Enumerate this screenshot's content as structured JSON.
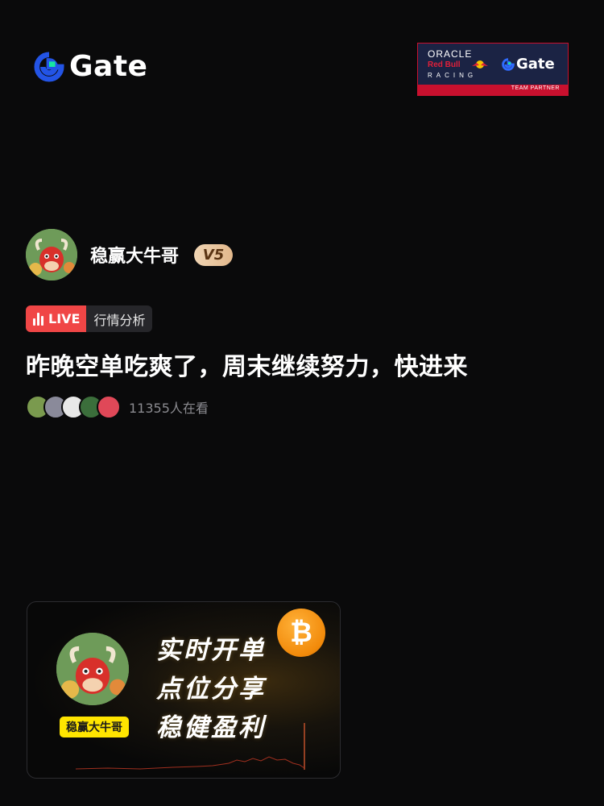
{
  "brand": {
    "name": "Gate",
    "accent": "#2354e6"
  },
  "partner_badge": {
    "line1": "ORACLE",
    "line2": "Red Bull",
    "line3": "RACING",
    "partner_name": "Gate",
    "tagline": "TEAM PARTNER"
  },
  "host": {
    "name": "稳赢大牛哥",
    "level": "V5"
  },
  "live": {
    "badge": "LIVE",
    "category": "行情分析",
    "badge_color": "#f04646"
  },
  "stream": {
    "title": "昨晚空单吃爽了，周末继续努力，快进来",
    "viewer_count": "11355人在看"
  },
  "promo_card": {
    "host_label": "稳赢大牛哥",
    "lines": [
      "实时开单",
      "点位分享",
      "稳健盈利"
    ],
    "coin_symbol": "₿"
  }
}
